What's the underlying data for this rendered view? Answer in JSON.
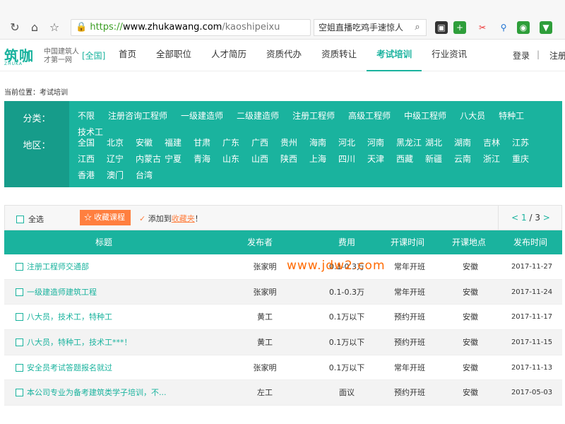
{
  "browser": {
    "url_https": "https://",
    "url_host": "www.zhukawang.com",
    "url_path": "/kaoshipeixu",
    "search_text": "空姐直播吃鸡手速惊人"
  },
  "header": {
    "logo_text": "筑咖",
    "logo_sub": "ZHUKA",
    "slogan": "中国建筑人才第一网",
    "region": "[全国]",
    "nav": [
      "首页",
      "全部职位",
      "人才简历",
      "资质代办",
      "资质转让",
      "考试培训",
      "行业资讯"
    ],
    "active_nav": "考试培训",
    "login": "登录",
    "separator": "|",
    "register": "注册"
  },
  "breadcrumb": "当前位置：考试培训",
  "filter": {
    "category_label": "分类：",
    "categories": [
      "不限",
      "注册咨询工程师",
      "一级建造师",
      "二级建造师",
      "注册工程师",
      "高级工程师",
      "中级工程师",
      "八大员",
      "特种工",
      "技术工"
    ],
    "region_label": "地区：",
    "regions": [
      "全国",
      "北京",
      "安徽",
      "福建",
      "甘肃",
      "广东",
      "广西",
      "贵州",
      "海南",
      "河北",
      "河南",
      "黑龙江",
      "湖北",
      "湖南",
      "吉林",
      "江苏",
      "江西",
      "辽宁",
      "内蒙古",
      "宁夏",
      "青海",
      "山东",
      "山西",
      "陕西",
      "上海",
      "四川",
      "天津",
      "西藏",
      "新疆",
      "云南",
      "浙江",
      "重庆",
      "香港",
      "澳门",
      "台湾"
    ]
  },
  "toolbar": {
    "select_all": "全选",
    "fav_button": "收藏课程",
    "hint_prefix": "添加到",
    "hint_link": "收藏夹",
    "hint_suffix": "！",
    "page_current": "1",
    "page_sep": " / ",
    "page_total": "3",
    "prev": "<",
    "next": ">"
  },
  "table": {
    "headers": [
      "标题",
      "发布者",
      "费用",
      "开课时间",
      "开课地点",
      "发布时间"
    ],
    "rows": [
      {
        "title": "注册工程师交通部",
        "publisher": "张家明",
        "fee": "0.1-0.3万",
        "time": "常年开班",
        "place": "安徽",
        "date": "2017-11-27"
      },
      {
        "title": "一级建造师建筑工程",
        "publisher": "张家明",
        "fee": "0.1-0.3万",
        "time": "常年开班",
        "place": "安徽",
        "date": "2017-11-24"
      },
      {
        "title": "八大员，技术工，特种工",
        "publisher": "黄工",
        "fee": "0.1万以下",
        "time": "预约开班",
        "place": "安徽",
        "date": "2017-11-17"
      },
      {
        "title": "八大员，特种工，技术工***！",
        "publisher": "黄工",
        "fee": "0.1万以下",
        "time": "预约开班",
        "place": "安徽",
        "date": "2017-11-15"
      },
      {
        "title": "安全员考试答题报名就过",
        "publisher": "张家明",
        "fee": "0.1万以下",
        "time": "常年开班",
        "place": "安徽",
        "date": "2017-11-13"
      },
      {
        "title": "本公司专业为备考建筑类学子培训，不...",
        "publisher": "左工",
        "fee": "面议",
        "time": "预约开班",
        "place": "安徽",
        "date": "2017-05-03"
      }
    ]
  },
  "watermark": "www.jdw2.com",
  "colors": {
    "accent": "#1ab39e",
    "orange": "#ff7f3f"
  }
}
